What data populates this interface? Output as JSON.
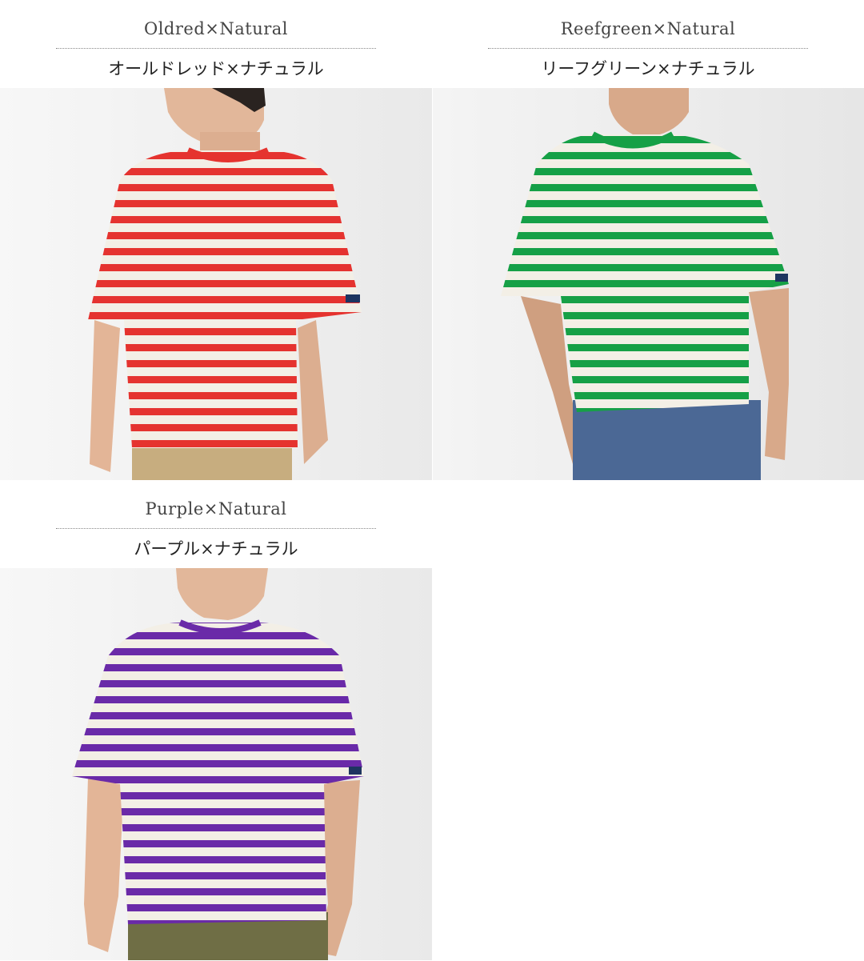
{
  "products": [
    {
      "name_en": "Oldred×Natural",
      "name_jp": "オールドレッド×ナチュラル",
      "stripe_color": "#e5332f",
      "base_color": "#f3efe6",
      "pants_color": "#c7ad7f"
    },
    {
      "name_en": "Reefgreen×Natural",
      "name_jp": "リーフグリーン×ナチュラル",
      "stripe_color": "#16a046",
      "base_color": "#f3efe6",
      "pants_color": "#3c5c8c"
    },
    {
      "name_en": "Purple×Natural",
      "name_jp": "パープル×ナチュラル",
      "stripe_color": "#6a2aa8",
      "base_color": "#f3efe6",
      "pants_color": "#6f6e45"
    }
  ]
}
